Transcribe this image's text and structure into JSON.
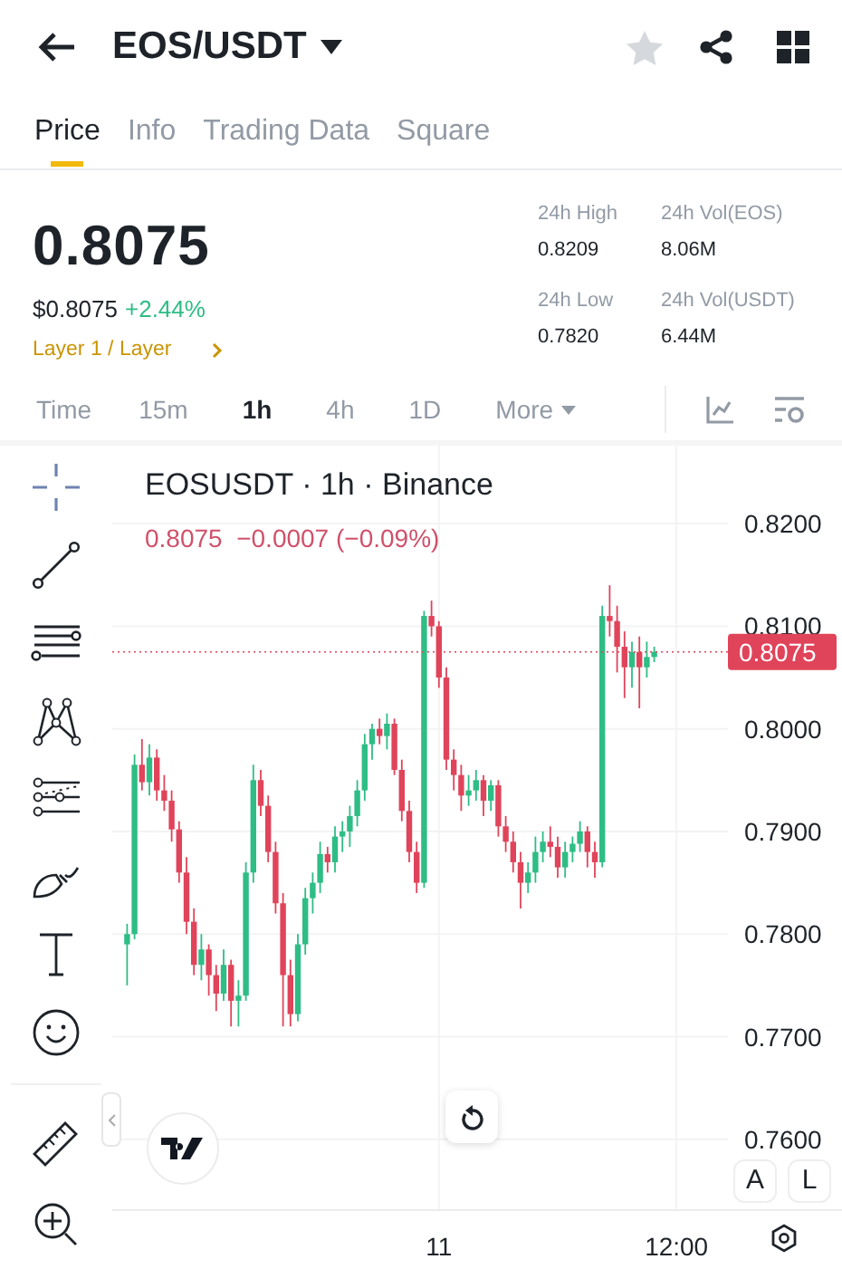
{
  "header": {
    "title": "EOS/USDT",
    "favorite": false
  },
  "tabs": [
    {
      "label": "Price",
      "selected": true
    },
    {
      "label": "Info",
      "selected": false
    },
    {
      "label": "Trading Data",
      "selected": false
    },
    {
      "label": "Square",
      "selected": false
    }
  ],
  "ticker": {
    "price": "0.8075",
    "usd_price": "$0.8075",
    "change": "+2.44%",
    "tag": "Layer 1 / Layer",
    "stats": [
      {
        "label": "24h High",
        "value": "0.8209"
      },
      {
        "label": "24h Vol(EOS)",
        "value": "8.06M"
      },
      {
        "label": "24h Low",
        "value": "0.7820"
      },
      {
        "label": "24h Vol(USDT)",
        "value": "6.44M"
      }
    ]
  },
  "intervals": [
    {
      "label": "Time",
      "selected": false
    },
    {
      "label": "15m",
      "selected": false
    },
    {
      "label": "1h",
      "selected": true
    },
    {
      "label": "4h",
      "selected": false
    },
    {
      "label": "1D",
      "selected": false
    },
    {
      "label": "More",
      "selected": false
    }
  ],
  "chart": {
    "title": "EOSUSDT · 1h · Binance",
    "legend": "0.8075  −0.0007 (−0.09%)",
    "scale_buttons": [
      "A",
      "L"
    ],
    "chart_data": {
      "type": "candlestick",
      "categories": [
        null,
        null,
        null,
        null,
        null,
        null,
        null,
        null,
        null,
        null,
        null,
        null,
        null,
        null,
        null,
        null,
        null,
        null,
        null,
        null,
        null,
        null,
        null,
        null,
        null,
        null,
        null,
        null,
        null,
        null,
        null,
        null,
        null,
        null,
        null,
        null,
        null,
        null,
        null,
        null,
        null,
        null,
        "11",
        null,
        null,
        null,
        null,
        null,
        null,
        null,
        null,
        null,
        null,
        null,
        null,
        null,
        null,
        null,
        null,
        null,
        null,
        null,
        null,
        null,
        null,
        null,
        null,
        null,
        null,
        null,
        null,
        null,
        null,
        null,
        "12:00",
        null,
        null,
        null,
        null
      ],
      "ohlc": [
        [
          0.779,
          0.781,
          0.775,
          0.78
        ],
        [
          0.78,
          0.7975,
          0.7795,
          0.7965
        ],
        [
          0.7965,
          0.799,
          0.794,
          0.7948
        ],
        [
          0.7948,
          0.7985,
          0.7935,
          0.7972
        ],
        [
          0.7972,
          0.798,
          0.793,
          0.794
        ],
        [
          0.794,
          0.7955,
          0.792,
          0.793
        ],
        [
          0.793,
          0.794,
          0.789,
          0.7902
        ],
        [
          0.7902,
          0.791,
          0.785,
          0.786
        ],
        [
          0.786,
          0.7875,
          0.78,
          0.7812
        ],
        [
          0.7812,
          0.7825,
          0.776,
          0.777
        ],
        [
          0.777,
          0.78,
          0.7755,
          0.7785
        ],
        [
          0.7785,
          0.779,
          0.774,
          0.776
        ],
        [
          0.776,
          0.777,
          0.7725,
          0.7742
        ],
        [
          0.7742,
          0.7785,
          0.7735,
          0.777
        ],
        [
          0.777,
          0.7775,
          0.771,
          0.7735
        ],
        [
          0.7735,
          0.7755,
          0.771,
          0.774
        ],
        [
          0.774,
          0.787,
          0.7735,
          0.786
        ],
        [
          0.786,
          0.7965,
          0.785,
          0.795
        ],
        [
          0.795,
          0.796,
          0.7915,
          0.7925
        ],
        [
          0.7925,
          0.7935,
          0.787,
          0.788
        ],
        [
          0.788,
          0.789,
          0.782,
          0.783
        ],
        [
          0.783,
          0.784,
          0.771,
          0.776
        ],
        [
          0.776,
          0.7775,
          0.771,
          0.7722
        ],
        [
          0.7722,
          0.78,
          0.7715,
          0.779
        ],
        [
          0.779,
          0.7845,
          0.778,
          0.7835
        ],
        [
          0.7835,
          0.786,
          0.782,
          0.785
        ],
        [
          0.785,
          0.789,
          0.784,
          0.7878
        ],
        [
          0.7878,
          0.7885,
          0.786,
          0.787
        ],
        [
          0.787,
          0.7905,
          0.786,
          0.7895
        ],
        [
          0.7895,
          0.791,
          0.788,
          0.79
        ],
        [
          0.79,
          0.7925,
          0.7885,
          0.7915
        ],
        [
          0.7915,
          0.795,
          0.7905,
          0.794
        ],
        [
          0.794,
          0.7995,
          0.793,
          0.7985
        ],
        [
          0.7985,
          0.8005,
          0.797,
          0.8
        ],
        [
          0.8,
          0.801,
          0.7985,
          0.7993
        ],
        [
          0.7993,
          0.8015,
          0.798,
          0.8005
        ],
        [
          0.8005,
          0.801,
          0.7955,
          0.796
        ],
        [
          0.796,
          0.797,
          0.791,
          0.792
        ],
        [
          0.792,
          0.793,
          0.787,
          0.788
        ],
        [
          0.788,
          0.789,
          0.784,
          0.785
        ],
        [
          0.785,
          0.8115,
          0.7845,
          0.811
        ],
        [
          0.811,
          0.8125,
          0.809,
          0.81
        ],
        [
          0.81,
          0.8105,
          0.804,
          0.805
        ],
        [
          0.805,
          0.806,
          0.796,
          0.797
        ],
        [
          0.797,
          0.798,
          0.794,
          0.7955
        ],
        [
          0.7955,
          0.7965,
          0.792,
          0.7935
        ],
        [
          0.7935,
          0.7955,
          0.7925,
          0.794
        ],
        [
          0.794,
          0.796,
          0.793,
          0.795
        ],
        [
          0.795,
          0.7955,
          0.7915,
          0.793
        ],
        [
          0.793,
          0.795,
          0.792,
          0.7945
        ],
        [
          0.7945,
          0.795,
          0.7895,
          0.7905
        ],
        [
          0.7905,
          0.7915,
          0.788,
          0.789
        ],
        [
          0.789,
          0.79,
          0.786,
          0.787
        ],
        [
          0.787,
          0.788,
          0.7825,
          0.785
        ],
        [
          0.785,
          0.787,
          0.784,
          0.786
        ],
        [
          0.786,
          0.7895,
          0.785,
          0.788
        ],
        [
          0.788,
          0.79,
          0.787,
          0.789
        ],
        [
          0.789,
          0.7905,
          0.7875,
          0.7885
        ],
        [
          0.7885,
          0.7895,
          0.7855,
          0.7865
        ],
        [
          0.7865,
          0.789,
          0.7855,
          0.788
        ],
        [
          0.788,
          0.7895,
          0.787,
          0.7888
        ],
        [
          0.7888,
          0.791,
          0.788,
          0.79
        ],
        [
          0.79,
          0.7905,
          0.7865,
          0.788
        ],
        [
          0.788,
          0.789,
          0.7855,
          0.787
        ],
        [
          0.787,
          0.812,
          0.7865,
          0.811
        ],
        [
          0.811,
          0.814,
          0.809,
          0.8105
        ],
        [
          0.8105,
          0.812,
          0.8055,
          0.808
        ],
        [
          0.808,
          0.8095,
          0.803,
          0.806
        ],
        [
          0.806,
          0.8085,
          0.804,
          0.8075
        ],
        [
          0.8075,
          0.809,
          0.802,
          0.806
        ],
        [
          0.806,
          0.8085,
          0.805,
          0.807
        ],
        [
          0.807,
          0.808,
          0.8065,
          0.8075
        ],
        null,
        null,
        null,
        null,
        null,
        null,
        null
      ],
      "grid": true,
      "ref_lines": [
        {
          "axis": "y",
          "value": 0.8075,
          "label": "0.8075"
        }
      ],
      "ylim": [
        0.7531,
        0.8276
      ],
      "yticks": [
        {
          "value": 0.82,
          "label": "0.8200"
        },
        {
          "value": 0.81,
          "label": "0.8100"
        },
        {
          "value": 0.8,
          "label": "0.8000"
        },
        {
          "value": 0.79,
          "label": "0.7900"
        },
        {
          "value": 0.78,
          "label": "0.7800"
        },
        {
          "value": 0.77,
          "label": "0.7700"
        },
        {
          "value": 0.76,
          "label": "0.7600"
        }
      ]
    }
  }
}
